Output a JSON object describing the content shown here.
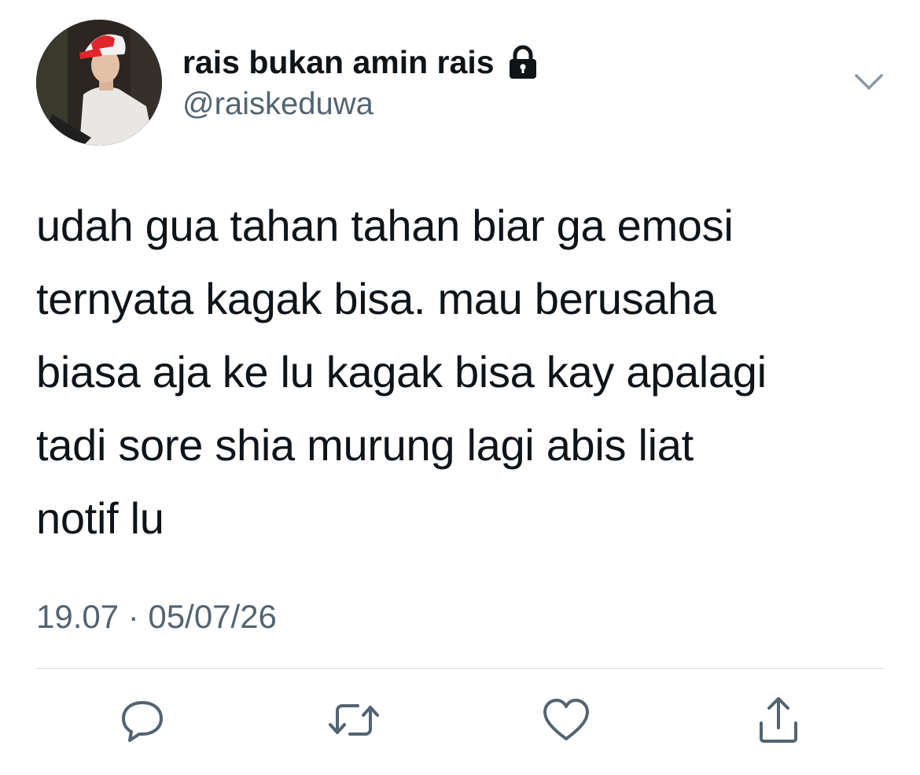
{
  "user": {
    "display_name": "rais bukan amin rais",
    "handle": "@raiskeduwa",
    "protected_icon": "lock-icon",
    "avatar_icon": "profile-photo"
  },
  "tweet": {
    "text": "udah gua tahan tahan biar ga emosi\nternyata kagak bisa. mau berusaha\nbiasa aja ke lu kagak bisa kay apalagi\ntadi sore shia murung lagi abis liat\nnotif lu",
    "timestamp": "19.07 · 05/07/26"
  },
  "menu": {
    "icon": "chevron-down-icon"
  },
  "actions": [
    {
      "name": "reply",
      "icon": "speech-bubble-icon"
    },
    {
      "name": "retweet",
      "icon": "retweet-icon"
    },
    {
      "name": "like",
      "icon": "heart-icon"
    },
    {
      "name": "share",
      "icon": "share-icon"
    }
  ],
  "colors": {
    "text": "#0f1419",
    "secondary": "#536471",
    "divider": "#d6dde3",
    "icon": "#536471"
  }
}
